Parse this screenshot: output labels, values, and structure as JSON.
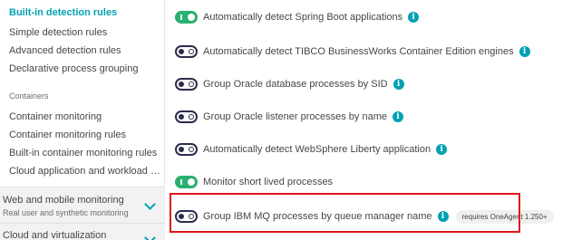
{
  "sidebar": {
    "active_item": "Built-in detection rules",
    "items": [
      "Simple detection rules",
      "Advanced detection rules",
      "Declarative process grouping"
    ],
    "containers_heading": "Containers",
    "container_items": [
      "Container monitoring",
      "Container monitoring rules",
      "Built-in container monitoring rules",
      "Cloud application and workload detec..."
    ],
    "groups": [
      {
        "title": "Web and mobile monitoring",
        "subtitle": "Real user and synthetic monitoring"
      },
      {
        "title": "Cloud and virtualization",
        "subtitle": ""
      }
    ]
  },
  "rules": [
    {
      "label": "Automatically detect Spring Boot applications",
      "enabled": true
    },
    {
      "label": "Automatically detect TIBCO BusinessWorks Container Edition engines",
      "enabled": false
    },
    {
      "label": "Group Oracle database processes by SID",
      "enabled": false
    },
    {
      "label": "Group Oracle listener processes by name",
      "enabled": false
    },
    {
      "label": "Automatically detect WebSphere Liberty application",
      "enabled": false
    },
    {
      "label": "Monitor short lived processes",
      "enabled": true
    },
    {
      "label": "Group IBM MQ processes by queue manager name",
      "enabled": false,
      "badge": "requires OneAgent 1.250+"
    }
  ],
  "colors": {
    "accent": "#00a1b2",
    "toggle_on": "#2ab06f",
    "highlight": "#e0161c"
  }
}
